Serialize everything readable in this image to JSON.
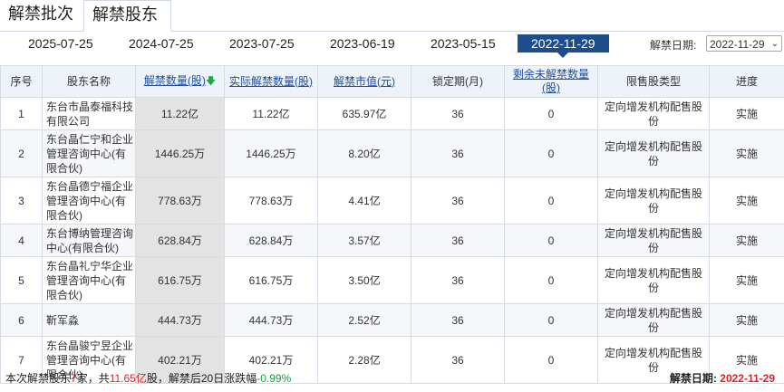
{
  "tabs": [
    "解禁批次",
    "解禁股东"
  ],
  "dates": [
    "2025-07-25",
    "2024-07-25",
    "2023-07-25",
    "2023-06-19",
    "2023-05-15",
    "2022-11-29"
  ],
  "date_picker": {
    "label": "解禁日期:",
    "value": "2022-11-29"
  },
  "table": {
    "headers": [
      "序号",
      "股东名称",
      "解禁数量(股)",
      "实际解禁数量(股)",
      "解禁市值(元)",
      "锁定期(月)",
      "剩余未解禁数量(股)",
      "限售股类型",
      "进度"
    ],
    "rows": [
      [
        "1",
        "东台市晶泰福科技有限公司",
        "11.22亿",
        "11.22亿",
        "635.97亿",
        "36",
        "0",
        "定向增发机构配售股份",
        "实施"
      ],
      [
        "2",
        "东台晶仁宁和企业管理咨询中心(有限合伙)",
        "1446.25万",
        "1446.25万",
        "8.20亿",
        "36",
        "0",
        "定向增发机构配售股份",
        "实施"
      ],
      [
        "3",
        "东台晶德宁福企业管理咨询中心(有限合伙)",
        "778.63万",
        "778.63万",
        "4.41亿",
        "36",
        "0",
        "定向增发机构配售股份",
        "实施"
      ],
      [
        "4",
        "东台博纳管理咨询中心(有限合伙)",
        "628.84万",
        "628.84万",
        "3.57亿",
        "36",
        "0",
        "定向增发机构配售股份",
        "实施"
      ],
      [
        "5",
        "东台晶礼宁华企业管理咨询中心(有限合伙)",
        "616.75万",
        "616.75万",
        "3.50亿",
        "36",
        "0",
        "定向增发机构配售股份",
        "实施"
      ],
      [
        "6",
        "靳军淼",
        "444.73万",
        "444.73万",
        "2.52亿",
        "36",
        "0",
        "定向增发机构配售股份",
        "实施"
      ],
      [
        "7",
        "东台晶骏宁昱企业管理咨询中心(有限合伙)",
        "402.21万",
        "402.21万",
        "2.28亿",
        "36",
        "0",
        "定向增发机构配售股份",
        "实施"
      ]
    ]
  },
  "footer": {
    "p1": "本次解禁股东",
    "count": "7",
    "p2": "家，共",
    "total": "11.65亿",
    "p3": "股，解禁后20日涨跌幅",
    "change": "-0.99%",
    "date_label": "解禁日期:",
    "date": "2022-11-29"
  },
  "colors": {
    "selected_date_bg": "#1d4d8b",
    "link": "#1f4e9c",
    "up": "#e02020",
    "down": "#18a046"
  }
}
